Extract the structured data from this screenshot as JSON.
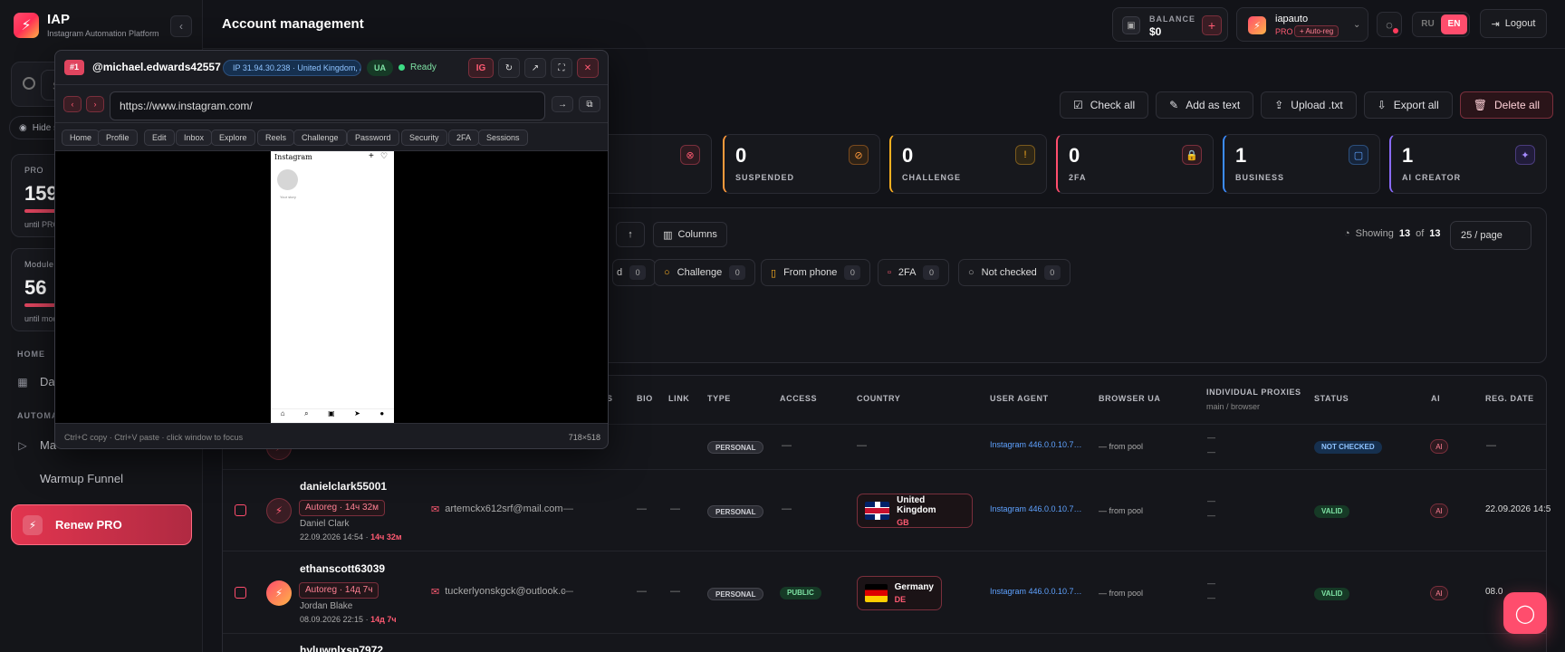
{
  "brand": {
    "title": "IAP",
    "subtitle": "Instagram Automation Platform"
  },
  "sidebar": {
    "search_placeholder": "S",
    "hide_stats": "Hide s",
    "plan_cards": [
      {
        "label": "PRO",
        "value": "159",
        "until": "until PRO"
      },
      {
        "label": "Module",
        "value": "56",
        "until": "until mod"
      }
    ],
    "sections": {
      "home": "HOME",
      "automation": "AUTOMA"
    },
    "items": [
      {
        "label": "Da"
      },
      {
        "label": "Ma"
      },
      {
        "label": "Warmup Funnel"
      }
    ],
    "renew_label": "Renew PRO"
  },
  "header": {
    "title": "Account management",
    "balance": {
      "label": "BALANCE",
      "value": "$0"
    },
    "user": {
      "name": "iapauto",
      "plan": "PRO",
      "auto": "+ Auto-reg"
    },
    "lang": {
      "ru": "RU",
      "en": "EN"
    },
    "logout": "Logout"
  },
  "actions": [
    "Check all",
    "Add as text",
    "Upload .txt",
    "Export all",
    "Delete all"
  ],
  "stats": [
    {
      "value": "0",
      "label": "SUSPENDED",
      "color": "#ff9a3c"
    },
    {
      "value": "0",
      "label": "CHALLENGE",
      "color": "#ffb020"
    },
    {
      "value": "0",
      "label": "2FA",
      "color": "#ff4d6d"
    },
    {
      "value": "1",
      "label": "BUSINESS",
      "color": "#3c8cff"
    },
    {
      "value": "1",
      "label": "AI CREATOR",
      "color": "#8a6bff"
    }
  ],
  "filters": {
    "columns_label": "Columns",
    "showing": {
      "label": "Showing",
      "count": "13",
      "of": "of",
      "total": "13"
    },
    "per_page": "25 / page",
    "chips": [
      {
        "label": "d",
        "count": "0"
      },
      {
        "label": "Challenge",
        "count": "0"
      },
      {
        "label": "From phone",
        "count": "0"
      },
      {
        "label": "2FA",
        "count": "0"
      },
      {
        "label": "Not checked",
        "count": "0"
      }
    ]
  },
  "table": {
    "headers": [
      "S",
      "BIO",
      "LINK",
      "TYPE",
      "ACCESS",
      "COUNTRY",
      "USER AGENT",
      "BROWSER UA",
      "INDIVIDUAL PROXIES",
      "STATUS",
      "AI",
      "REG. DATE"
    ],
    "proxies_sub": "main / browser",
    "rows": [
      {
        "type": "PERSONAL",
        "access": "—",
        "country": "—",
        "ua": "Instagram 446.0.0.10.7…",
        "pool": "— from pool",
        "proxy": "—",
        "status": "NOT CHECKED",
        "ai": "AI",
        "reg": "—"
      },
      {
        "username": "danielclark55001",
        "autoreg": "Autoreg · 14ч 32м",
        "fullname": "Daniel Clark",
        "date": "22.09.2026 14:54 ·",
        "age": "14ч 32м",
        "email": "artemckx612srf@mail.com",
        "bio": "—",
        "link": "—",
        "type": "PERSONAL",
        "access": "—",
        "country": "United Kingdom",
        "code": "GB",
        "ua": "Instagram 446.0.0.10.7…",
        "pool": "— from pool",
        "proxy": "—",
        "status": "VALID",
        "ai": "AI",
        "reg": "22.09.2026 14:5"
      },
      {
        "username": "ethanscott63039",
        "autoreg": "Autoreg · 14д 7ч",
        "fullname": "Jordan Blake",
        "date": "08.09.2026 22:15 ·",
        "age": "14д 7ч",
        "email": "tuckerlyonskgck@outlook.c",
        "bio": "—",
        "link": "—",
        "type": "PERSONAL",
        "access": "PUBLIC",
        "country": "Germany",
        "code": "DE",
        "ua": "Instagram 446.0.0.10.7…",
        "pool": "— from pool",
        "proxy": "—",
        "status": "VALID",
        "ai": "AI",
        "reg": "08.0"
      },
      {
        "username": "hyluwnlxsp7972"
      }
    ]
  },
  "popup": {
    "number": "#1",
    "handle": "@michael.edwards42557",
    "ip": "IP 31.94.30.238 · United Kingdom, A",
    "ua": "UA",
    "ready": "Ready",
    "ig_btn": "IG",
    "url": "https://www.instagram.com/",
    "tabs": [
      "Home",
      "Profile",
      "Edit",
      "Inbox",
      "Explore",
      "Reels",
      "Challenge",
      "Password",
      "Security",
      "2FA",
      "Sessions"
    ],
    "phone_title": "Instagram",
    "story_label": "Your story",
    "hint": "Ctrl+C copy · Ctrl+V paste · click window to focus",
    "size": "718×518"
  }
}
